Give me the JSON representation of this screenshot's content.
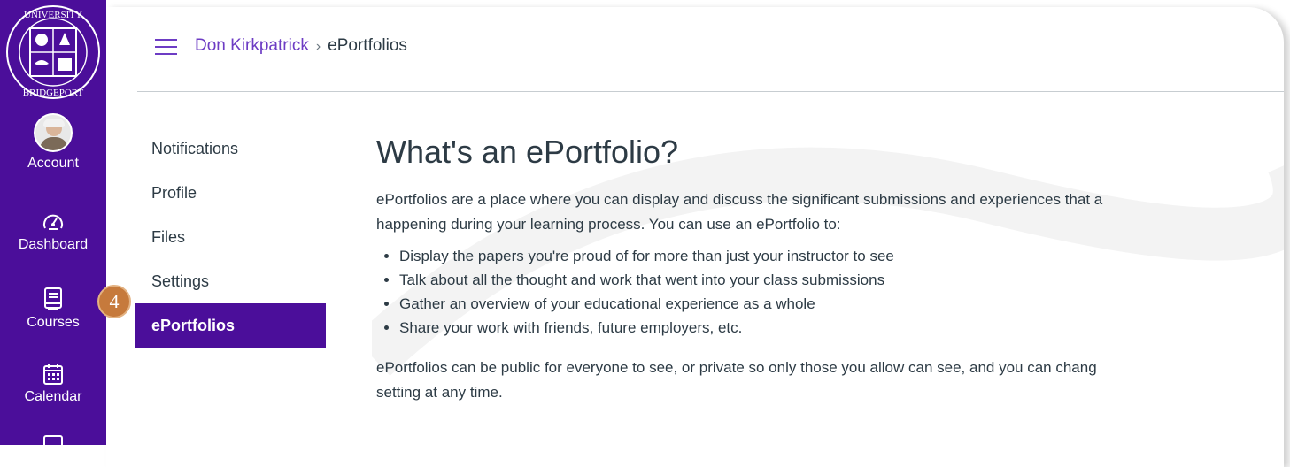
{
  "global_nav": {
    "logo_text": "UNIVERSITY OF BRIDGEPORT",
    "items": [
      {
        "label": "Account",
        "icon": "user-avatar"
      },
      {
        "label": "Dashboard",
        "icon": "dashboard-icon"
      },
      {
        "label": "Courses",
        "icon": "book-icon"
      },
      {
        "label": "Calendar",
        "icon": "calendar-icon"
      }
    ]
  },
  "header": {
    "breadcrumb_user": "Don Kirkpatrick",
    "breadcrumb_separator": "›",
    "breadcrumb_current": "ePortfolios"
  },
  "section_nav": {
    "items": [
      {
        "label": "Notifications"
      },
      {
        "label": "Profile"
      },
      {
        "label": "Files"
      },
      {
        "label": "Settings"
      },
      {
        "label": "ePortfolios",
        "active": true
      }
    ]
  },
  "step_badge": "4",
  "main": {
    "title": "What's an ePortfolio?",
    "intro_line1": "ePortfolios are a place where you can display and discuss the significant submissions and experiences that a",
    "intro_line2": "happening during your learning process. You can use an ePortfolio to:",
    "bullets": [
      "Display the papers you're proud of for more than just your instructor to see",
      "Talk about all the thought and work that went into your class submissions",
      "Gather an overview of your educational experience as a whole",
      "Share your work with friends, future employers, etc."
    ],
    "outro_line1": "ePortfolios can be public for everyone to see, or private so only those you allow can see, and you can chang",
    "outro_line2": "setting at any time."
  },
  "colors": {
    "nav_bg": "#4b0e9a",
    "link": "#6d3cc4",
    "badge": "#c67a3c",
    "text": "#2d3b45"
  }
}
